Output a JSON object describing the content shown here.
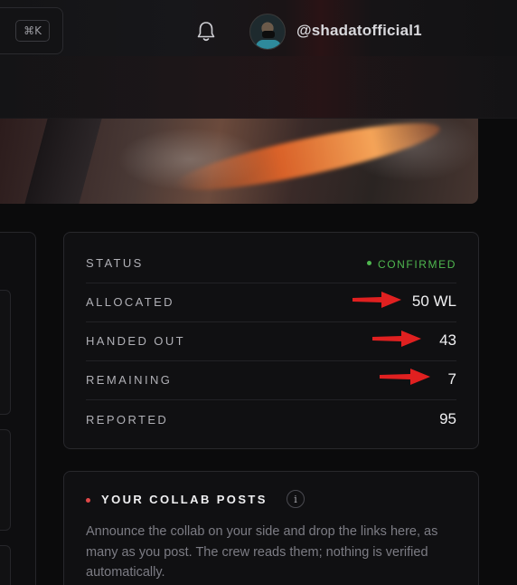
{
  "header": {
    "shortcut_hint": "⌘K",
    "username": "@shadatofficial1",
    "icons": {
      "notifications": "bell-icon",
      "avatar": "avatar"
    }
  },
  "status_card": {
    "rows": [
      {
        "label": "STATUS",
        "value": "CONFIRMED",
        "color": "#4fb84f"
      },
      {
        "label": "ALLOCATED",
        "value": "50 WL"
      },
      {
        "label": "HANDED OUT",
        "value": "43"
      },
      {
        "label": "REMAINING",
        "value": "7"
      },
      {
        "label": "REPORTED",
        "value": "95"
      }
    ]
  },
  "annotations": {
    "arrow_color": "#e02020"
  },
  "collab": {
    "title": "YOUR COLLAB POSTS",
    "info_icon": "i",
    "description": "Announce the collab on your side and drop the links here, as many as you post. The crew reads them; nothing is verified automatically."
  }
}
